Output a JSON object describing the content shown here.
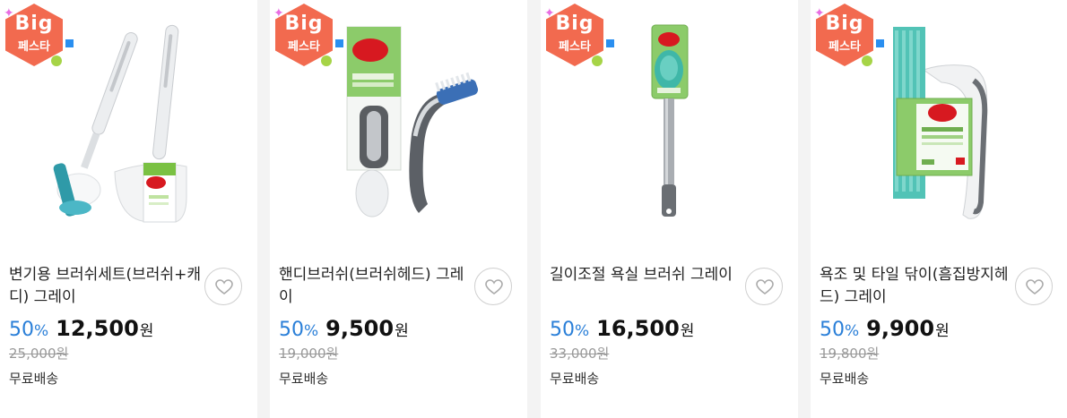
{
  "badge": {
    "line1": "Big",
    "line2": "페스타"
  },
  "colors": {
    "badge": "#f26a4f",
    "discount": "#2a7fd8",
    "brand_red": "#d71920",
    "brand_green": "#7ac143"
  },
  "products": [
    {
      "name": "변기용 브러쉬세트(브러쉬+캐디) 그레이",
      "discount": "50",
      "discount_symbol": "%",
      "price": "12,500",
      "currency": "원",
      "original_price": "25,000원",
      "shipping": "무료배송",
      "wishlist_icon": "heart-icon"
    },
    {
      "name": "핸디브러쉬(브러쉬헤드) 그레이",
      "discount": "50",
      "discount_symbol": "%",
      "price": "9,500",
      "currency": "원",
      "original_price": "19,000원",
      "shipping": "무료배송",
      "wishlist_icon": "heart-icon"
    },
    {
      "name": "길이조절 욕실 브러쉬 그레이",
      "discount": "50",
      "discount_symbol": "%",
      "price": "16,500",
      "currency": "원",
      "original_price": "33,000원",
      "shipping": "무료배송",
      "wishlist_icon": "heart-icon"
    },
    {
      "name": "욕조 및 타일 닦이(흠집방지헤드) 그레이",
      "discount": "50",
      "discount_symbol": "%",
      "price": "9,900",
      "currency": "원",
      "original_price": "19,800원",
      "shipping": "무료배송",
      "wishlist_icon": "heart-icon"
    }
  ]
}
